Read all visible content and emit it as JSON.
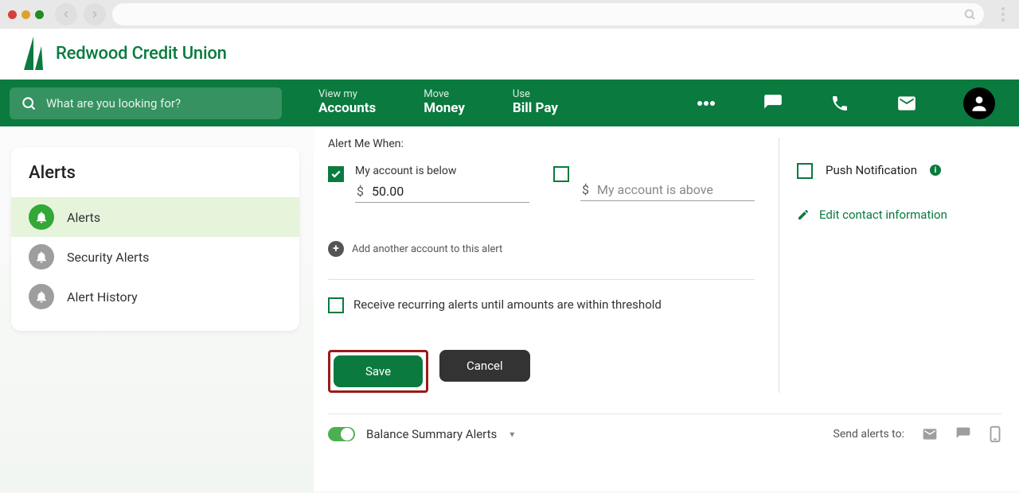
{
  "brand_name": "Redwood Credit Union",
  "search_placeholder": "What are you looking for?",
  "nav": {
    "accounts_top": "View my",
    "accounts_bottom": "Accounts",
    "money_top": "Move",
    "money_bottom": "Money",
    "bill_top": "Use",
    "bill_bottom": "Bill Pay"
  },
  "sidebar": {
    "title": "Alerts",
    "items": [
      "Alerts",
      "Security Alerts",
      "Alert History"
    ]
  },
  "config": {
    "section_label": "Alert Me When:",
    "below_label": "My account is below",
    "below_value": "50.00",
    "above_placeholder": "My account is above",
    "add_another": "Add another account to this alert",
    "recurring": "Receive recurring alerts until amounts are within threshold",
    "save": "Save",
    "cancel": "Cancel"
  },
  "right": {
    "push": "Push Notification",
    "edit": "Edit contact information"
  },
  "footer": {
    "title": "Balance Summary Alerts",
    "send_to": "Send alerts to:"
  }
}
